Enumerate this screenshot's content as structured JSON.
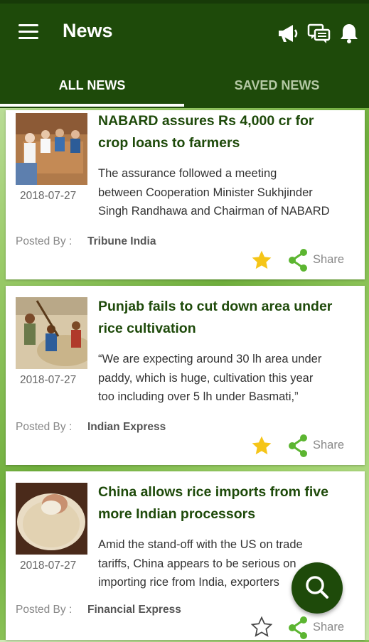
{
  "app": {
    "title": "News",
    "tabs": [
      {
        "label": "ALL NEWS",
        "active": true
      },
      {
        "label": "SAVED NEWS",
        "active": false
      }
    ],
    "colors": {
      "primary": "#1e4a0a",
      "star": "#f5c518",
      "share": "#5cb531"
    }
  },
  "articles": [
    {
      "headline_line1": "NABARD assures Rs 4,000 cr for",
      "headline_line2": "crop loans to farmers",
      "date": "2018-07-27",
      "summary_line1": "The assurance followed a meeting",
      "summary_line2": "between Cooperation Minister Sukhjinder",
      "summary_line3": "Singh Randhawa and Chairman of NABARD",
      "posted_by_label": "Posted By :",
      "source": "Tribune India",
      "share_label": "Share",
      "saved": true
    },
    {
      "headline_line1": "Punjab fails to cut down area under",
      "headline_line2": "rice cultivation",
      "date": "2018-07-27",
      "summary_line1": "“We are expecting around 30 lh area under",
      "summary_line2": "paddy, which is huge, cultivation this year",
      "summary_line3": "too including over 5 lh under Basmati,”",
      "posted_by_label": "Posted By :",
      "source": "Indian Express",
      "share_label": "Share",
      "saved": true
    },
    {
      "headline_line1": "China allows rice imports from five",
      "headline_line2": "more Indian processors",
      "date": "2018-07-27",
      "summary_line1": "Amid the stand-off with the US on trade",
      "summary_line2": "tariffs, China appears to be serious on",
      "summary_line3": "importing rice from India, exporters",
      "posted_by_label": "Posted By :",
      "source": "Financial Express",
      "share_label": "Share",
      "saved": false
    }
  ]
}
